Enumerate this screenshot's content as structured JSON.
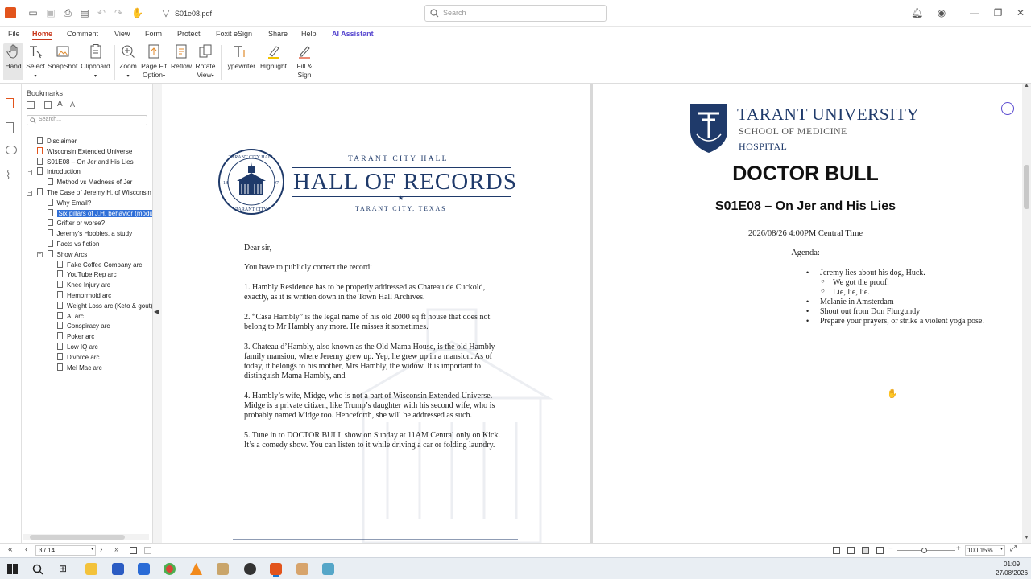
{
  "window": {
    "filename": "S01e08.pdf",
    "search_placeholder": "Search"
  },
  "menu": [
    "File",
    "Home",
    "Comment",
    "View",
    "Form",
    "Protect",
    "Foxit eSign",
    "Share",
    "Help",
    "AI Assistant"
  ],
  "ribbon": {
    "hand": "Hand",
    "select": "Select",
    "snapshot": "SnapShot",
    "clipboard": "Clipboard",
    "zoom": "Zoom",
    "pagefit1": "Page Fit",
    "pagefit2": "Option",
    "reflow": "Reflow",
    "rotate1": "Rotate",
    "rotate2": "View",
    "typewriter": "Typewriter",
    "highlight": "Highlight",
    "fill1": "Fill &",
    "fill2": "Sign"
  },
  "bookmarks": {
    "title": "Bookmarks",
    "search_placeholder": "Search...",
    "items": [
      "Disclaimer",
      "Wisconsin Extended Universe",
      "S01E08 – On Jer and His Lies",
      "Introduction",
      "Method vs Madness of Jer",
      "The Case of Jeremy H. of Wisconsin",
      "Why Email?",
      "Six pillars of J.H. behavior (modus operandi)",
      "Grifter or worse?",
      "Jeremy's Hobbies, a study",
      "Facts vs fiction",
      "Show Arcs",
      "Fake Coffee Company arc",
      "YouTube Rep arc",
      "Knee Injury arc",
      "Hemorrhoid arc",
      "Weight Loss arc (Keto & gout)",
      "AI arc",
      "Conspiracy arc",
      "Poker arc",
      "Low IQ arc",
      "Divorce arc",
      "Mel Mac arc"
    ]
  },
  "page1": {
    "header_small": "TARANT CITY HALL",
    "header_big": "HALL OF RECORDS",
    "header_sub": "TARANT CITY, TEXAS",
    "seal_top": "TARANT CITY HALL",
    "seal_bottom": "TARANT CITY",
    "seal_left": "18",
    "seal_right": "97",
    "greeting": "Dear sir,",
    "intro": "You have to publicly correct the record:",
    "p1a": "1. Hambly Residence has to be properly addressed as Chateau de Cuckold,",
    "p1b": "exactly, as it is written down in the Town Hall Archives.",
    "p2a": "2. “Casa Hambly” is the legal name of his old 2000 sq ft house that does not",
    "p2b": "belong to Mr Hambly any more. He misses it sometimes.",
    "p3a": "3. Chateau d’Hambly, also known as the Old Mama House, is the old Hambly",
    "p3b": "family mansion, where Jeremy grew up. Yep, he grew up in a mansion. As of",
    "p3c": "today, it belongs to his mother, Mrs Hambly, the widow. It is important to",
    "p3d": "distinguish Mama Hambly, and",
    "p4a": "4. Hambly’s wife, Midge, who is not a part of Wisconsin Extended Universe.",
    "p4b": "Midge is a private citizen, like Trump’s daughter with his second wife, who is",
    "p4c": "probably named Midge too. Henceforth, she will be addressed as such.",
    "p5a": "5. Tune in to DOCTOR BULL show on Sunday at 11AM Central only on Kick.",
    "p5b": "It’s a comedy show. You can listen to it while driving a car or folding laundry."
  },
  "page2": {
    "uni1": "TARANT UNIVERSITY",
    "uni2": "SCHOOL OF MEDICINE",
    "uni3": "HOSPITAL",
    "title": "DOCTOR BULL",
    "subtitle": "S01E08 – On Jer and His Lies",
    "datetime": "2026/08/26 4:00PM Central Time",
    "agenda": "Agenda:",
    "a1": "Jeremy lies about his dog, Huck.",
    "a1s1": "We got the proof.",
    "a1s2": "Lie, lie, lie.",
    "a2": "Melanie in Amsterdam",
    "a3": "Shout out from Don Flurgundy",
    "a4": "Prepare your prayers, or strike a violent yoga pose."
  },
  "status": {
    "page": "3 / 14",
    "zoom": "100.15%"
  },
  "clock": {
    "time": "01:09",
    "date": "27/08/2026"
  },
  "colors": {
    "accent": "#c8361b",
    "ai": "#5a4ad0",
    "select": "#2f6fd8",
    "navy": "#1f3a6a"
  }
}
